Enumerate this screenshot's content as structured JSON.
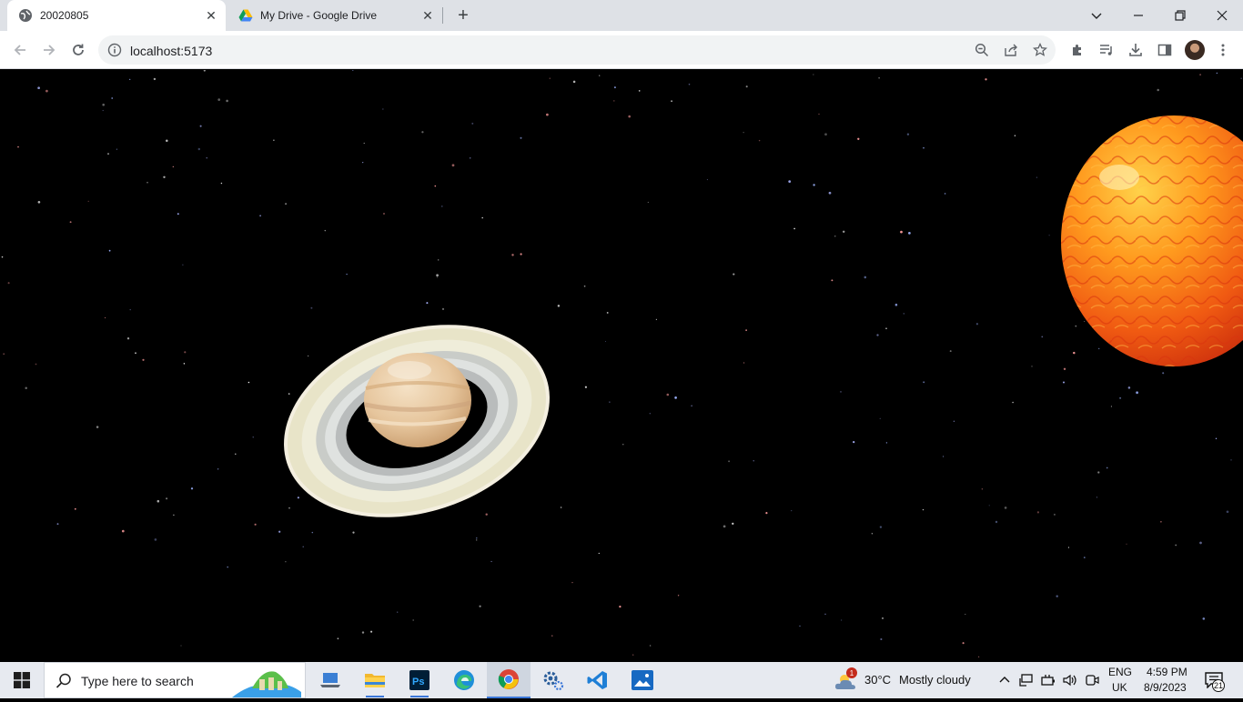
{
  "browser": {
    "tabs": [
      {
        "title": "20020805",
        "active": true
      },
      {
        "title": "My Drive - Google Drive",
        "active": false
      }
    ],
    "url": "localhost:5173"
  },
  "scene": {
    "objects": [
      "saturn",
      "sun",
      "starfield"
    ]
  },
  "taskbar": {
    "search_placeholder": "Type here to search",
    "apps": [
      "file-explorer-laptop",
      "file-explorer",
      "photoshop",
      "edge",
      "chrome",
      "settings",
      "vscode",
      "photos"
    ],
    "active_app": "chrome",
    "weather": {
      "temp": "30°C",
      "condition": "Mostly cloudy",
      "badge": "1"
    },
    "language": {
      "line1": "ENG",
      "line2": "UK"
    },
    "clock": {
      "time": "4:59 PM",
      "date": "8/9/2023"
    },
    "notifications": "21"
  }
}
